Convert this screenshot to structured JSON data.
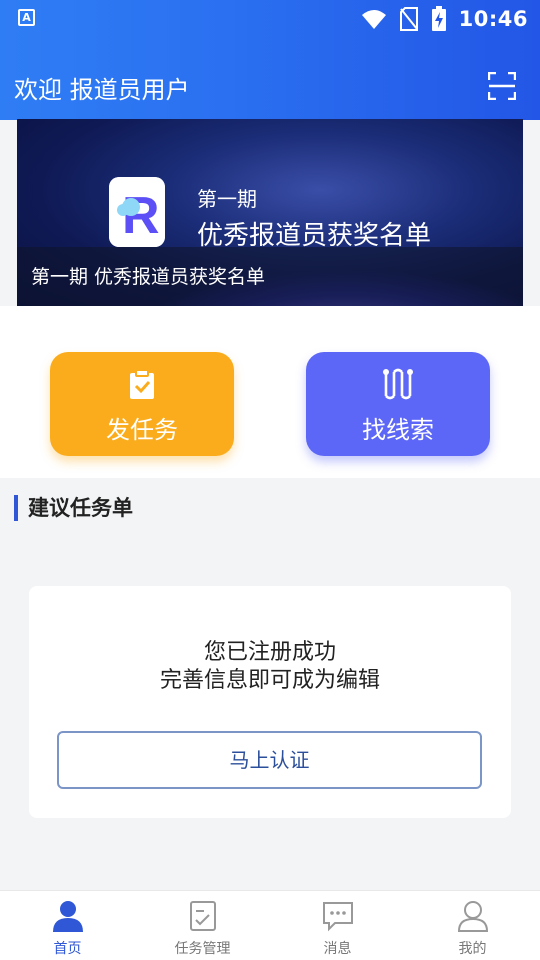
{
  "status_bar": {
    "time": "10:46",
    "app_glyph": "A"
  },
  "header": {
    "title": "欢迎  报道员用户"
  },
  "banner": {
    "issue_text": "第一期",
    "headline": "优秀报道员获奖名单",
    "caption": "第一期 优秀报道员获奖名单",
    "logo_letter": "R"
  },
  "actions": [
    {
      "label": "发任务",
      "icon": "clipboard-icon",
      "color": "#fbac1c"
    },
    {
      "label": "找线索",
      "icon": "route-icon",
      "color": "#5d67f7"
    }
  ],
  "section": {
    "title": "建议任务单"
  },
  "card": {
    "line1": "您已注册成功",
    "line2": "完善信息即可成为编辑",
    "button_label": "马上认证"
  },
  "tabs": [
    {
      "label": "首页",
      "icon": "user-filled-icon",
      "active": true
    },
    {
      "label": "任务管理",
      "icon": "task-check-icon",
      "active": false
    },
    {
      "label": "消息",
      "icon": "message-icon",
      "active": false
    },
    {
      "label": "我的",
      "icon": "user-outline-icon",
      "active": false
    }
  ],
  "colors": {
    "header": "#2a6ff0",
    "accent": "#2f57d6",
    "task_button": "#fbac1c",
    "clue_button": "#5d67f7"
  }
}
